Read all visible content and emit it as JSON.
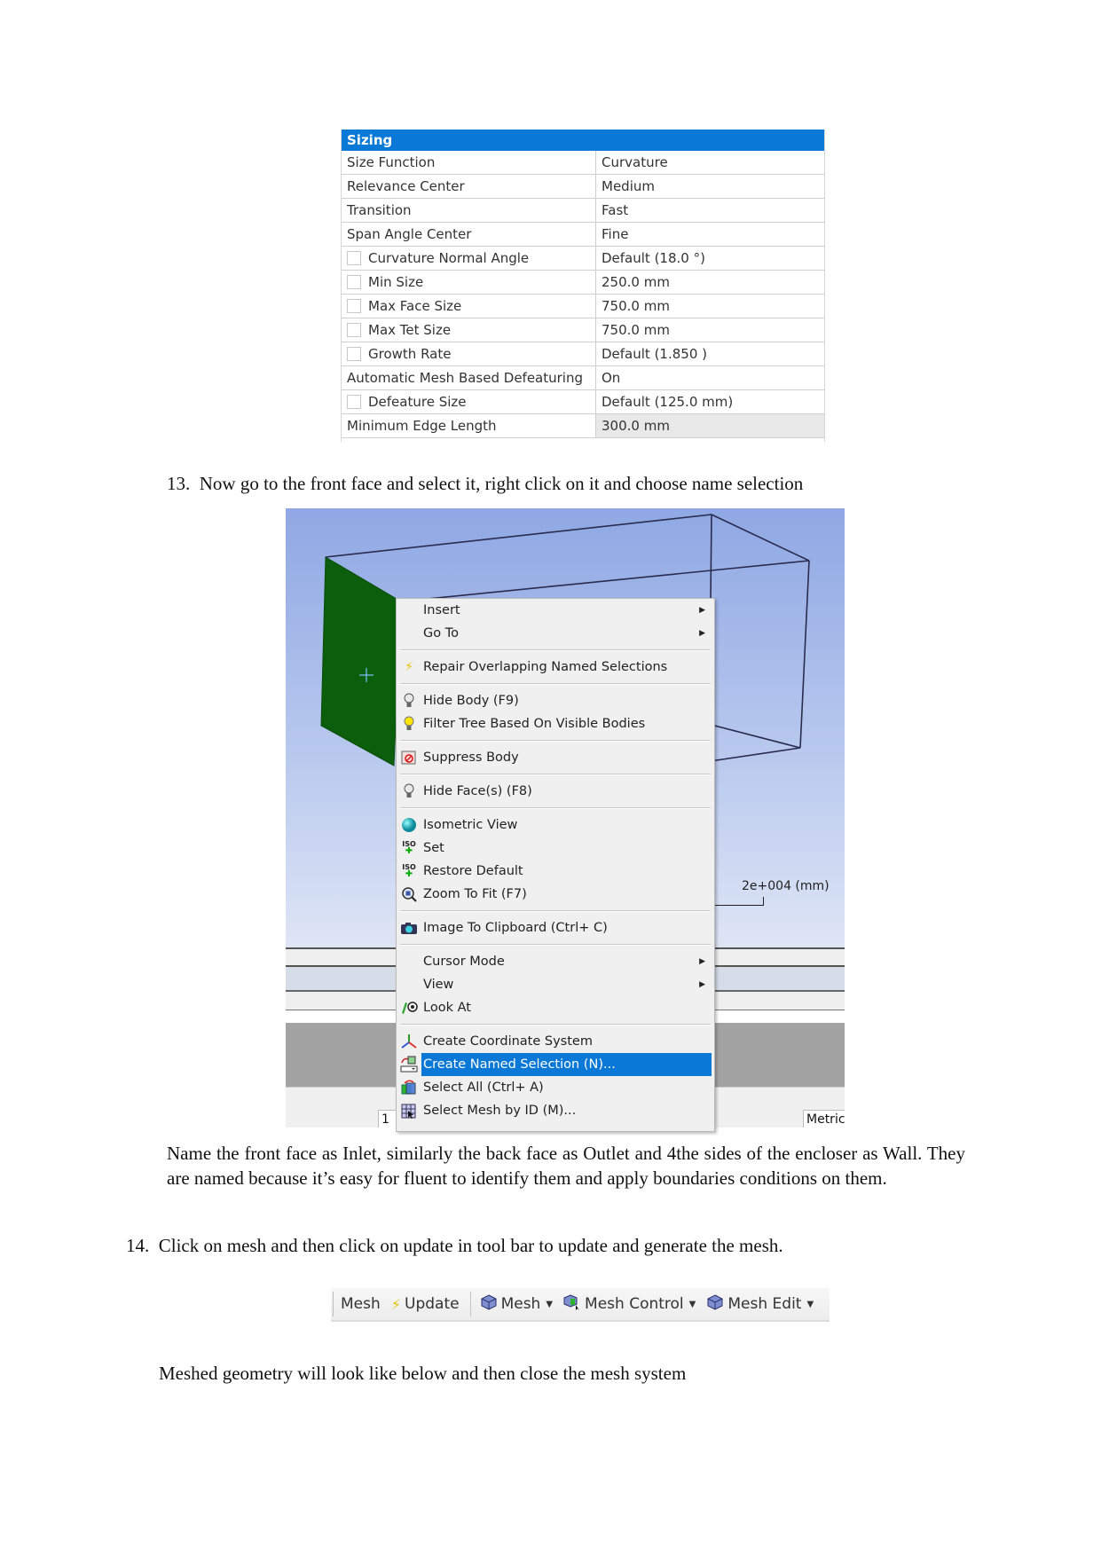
{
  "sizing_table": {
    "header": "Sizing",
    "rows": [
      {
        "label": "Size Function",
        "value": "Curvature",
        "checkbox": false
      },
      {
        "label": "Relevance Center",
        "value": "Medium",
        "checkbox": false
      },
      {
        "label": "Transition",
        "value": "Fast",
        "checkbox": false
      },
      {
        "label": "Span Angle Center",
        "value": "Fine",
        "checkbox": false
      },
      {
        "label": "Curvature Normal Angle",
        "value": "Default (18.0 °)",
        "checkbox": true
      },
      {
        "label": "Min Size",
        "value": "250.0 mm",
        "checkbox": true
      },
      {
        "label": "Max Face Size",
        "value": "750.0 mm",
        "checkbox": true
      },
      {
        "label": "Max Tet Size",
        "value": "750.0 mm",
        "checkbox": true
      },
      {
        "label": "Growth Rate",
        "value": "Default (1.850 )",
        "checkbox": true
      },
      {
        "label": "Automatic Mesh Based Defeaturing",
        "value": "On",
        "checkbox": false
      },
      {
        "label": "Defeature Size",
        "value": "Default (125.0 mm)",
        "checkbox": true
      },
      {
        "label": "Minimum Edge Length",
        "value": "300.0 mm",
        "checkbox": false
      }
    ]
  },
  "step13": {
    "number": "13.",
    "text": "Now go to the front face and select it, right click on it and choose name selection"
  },
  "viewport": {
    "scale_label": "2e+004 (mm)",
    "status_left": "1",
    "status_right": "Metric"
  },
  "context_menu": {
    "items": [
      {
        "label": "Insert",
        "icon": "none",
        "submenu": true
      },
      {
        "label": "Go To",
        "icon": "none",
        "submenu": true
      },
      {
        "label": "Repair Overlapping Named Selections",
        "icon": "lightning-icon"
      },
      {
        "label": "Hide Body (F9)",
        "icon": "lightbulb-off-icon"
      },
      {
        "label": "Filter Tree Based On Visible Bodies",
        "icon": "lightbulb-on-icon"
      },
      {
        "label": "Suppress Body",
        "icon": "suppress-icon"
      },
      {
        "label": "Hide Face(s) (F8)",
        "icon": "lightbulb-off-icon"
      },
      {
        "label": "Isometric View",
        "icon": "sphere-icon"
      },
      {
        "label": "Set",
        "icon": "iso-axes-icon"
      },
      {
        "label": "Restore Default",
        "icon": "iso-axes-icon"
      },
      {
        "label": "Zoom To Fit (F7)",
        "icon": "zoom-fit-icon"
      },
      {
        "label": "Image To Clipboard (Ctrl+ C)",
        "icon": "camera-icon"
      },
      {
        "label": "Cursor Mode",
        "icon": "none",
        "submenu": true
      },
      {
        "label": "View",
        "icon": "none",
        "submenu": true
      },
      {
        "label": "Look At",
        "icon": "look-at-icon"
      },
      {
        "label": "Create Coordinate System",
        "icon": "coordinate-system-icon"
      },
      {
        "label": "Create Named Selection (N)...",
        "icon": "named-selection-icon",
        "highlighted": true
      },
      {
        "label": "Select All (Ctrl+ A)",
        "icon": "select-all-icon"
      },
      {
        "label": "Select Mesh by ID (M)...",
        "icon": "select-mesh-icon"
      }
    ],
    "highlight_color": "#0a78d6"
  },
  "naming_paragraph": "Name the front face as Inlet, similarly the back face as Outlet and 4the sides of the encloser as Wall. They are named because it’s easy for fluent to identify them and apply boundaries conditions on them.",
  "step14": {
    "number": "14.",
    "text": "Click on mesh and then click on update in tool bar to update and generate the mesh."
  },
  "toolbar": {
    "context_label": "Mesh",
    "update_label": "Update",
    "mesh_label": "Mesh",
    "mesh_control_label": "Mesh Control",
    "mesh_edit_label": "Mesh Edit"
  },
  "closing_text": "Meshed geometry will look like below and then close the mesh system",
  "colors": {
    "header_blue": "#0a78d6",
    "face_green": "#0b5e0b"
  }
}
